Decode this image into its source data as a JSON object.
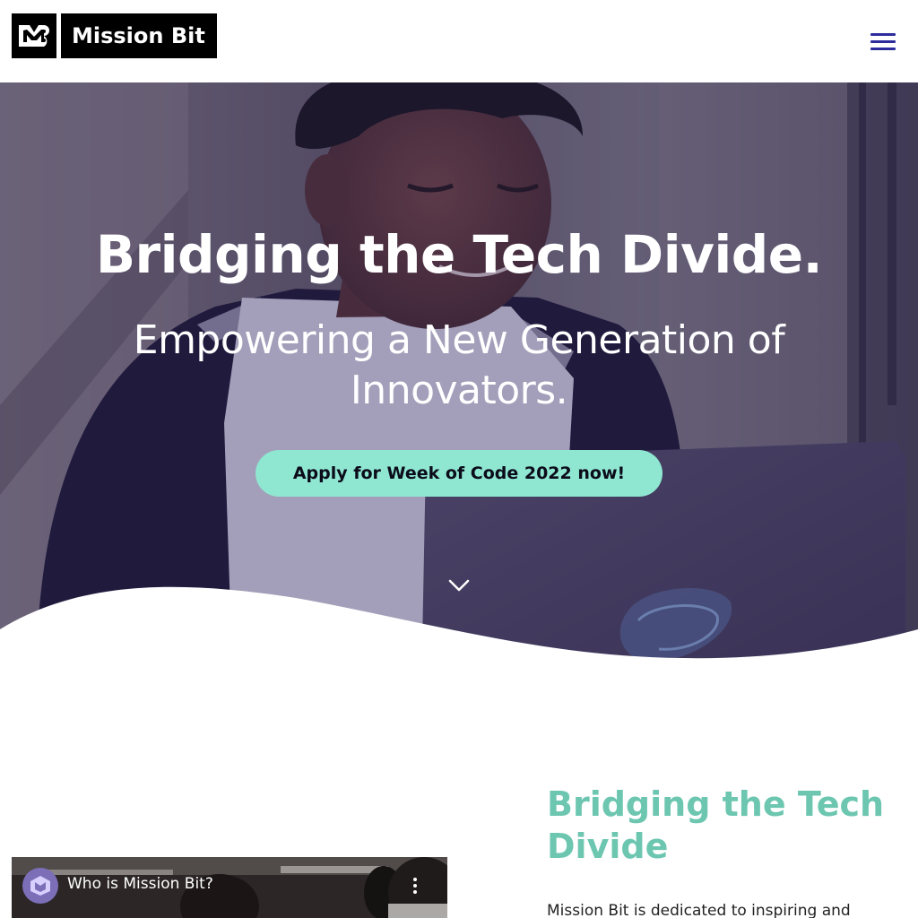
{
  "header": {
    "logo_text": "Mission Bit",
    "logo_mark": "MB-logo-icon",
    "menu_icon": "hamburger-menu-icon",
    "menu_color": "#2c2c9c"
  },
  "hero": {
    "title": "Bridging the Tech Divide.",
    "subtitle": "Empowering a New Generation of Innovators.",
    "cta_label": "Apply for Week of Code 2022 now!",
    "cta_color": "#8fe6d1",
    "scroll_icon": "chevron-down-icon"
  },
  "section": {
    "title": "Bridging the Tech Divide",
    "title_color": "#6cc6b0",
    "body_start": "Mission Bit is dedicated to inspiring and"
  },
  "video": {
    "title": "Who is Mission Bit?",
    "more_icon": "more-vertical-icon"
  }
}
